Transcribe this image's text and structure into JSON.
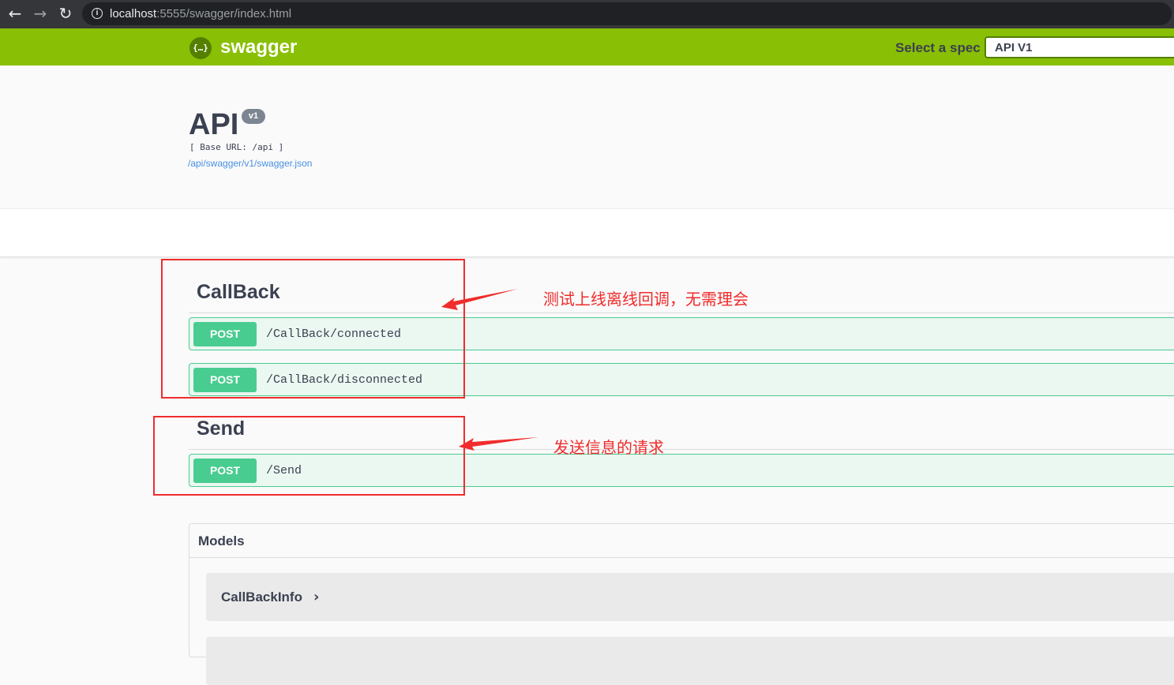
{
  "browser": {
    "back_icon": "arrow-left-icon",
    "forward_icon": "arrow-right-icon",
    "reload_icon": "reload-icon",
    "info_icon": "info-icon",
    "url_host": "localhost",
    "url_rest": ":5555/swagger/index.html"
  },
  "topbar": {
    "logo_text": "swagger",
    "spec_label": "Select a spec",
    "spec_value": "API V1"
  },
  "info": {
    "title": "API",
    "version": "v1",
    "base_url": "[ Base URL: /api ]",
    "spec_link": "/api/swagger/v1/swagger.json"
  },
  "tags": [
    {
      "name": "CallBack",
      "operations": [
        {
          "method": "POST",
          "path": "/CallBack/connected"
        },
        {
          "method": "POST",
          "path": "/CallBack/disconnected"
        }
      ]
    },
    {
      "name": "Send",
      "operations": [
        {
          "method": "POST",
          "path": "/Send"
        }
      ]
    }
  ],
  "annotations": {
    "callback_note": "测试上线离线回调，无需理会",
    "send_note": "发送信息的请求",
    "color": "#f02c2c"
  },
  "models": {
    "title": "Models",
    "items": [
      {
        "name": "CallBackInfo",
        "chevron": "›"
      }
    ]
  },
  "colors": {
    "topbar": "#89bf04",
    "post": "#49cc90",
    "post_bg": "#ebf7f1",
    "text": "#3b4151"
  }
}
